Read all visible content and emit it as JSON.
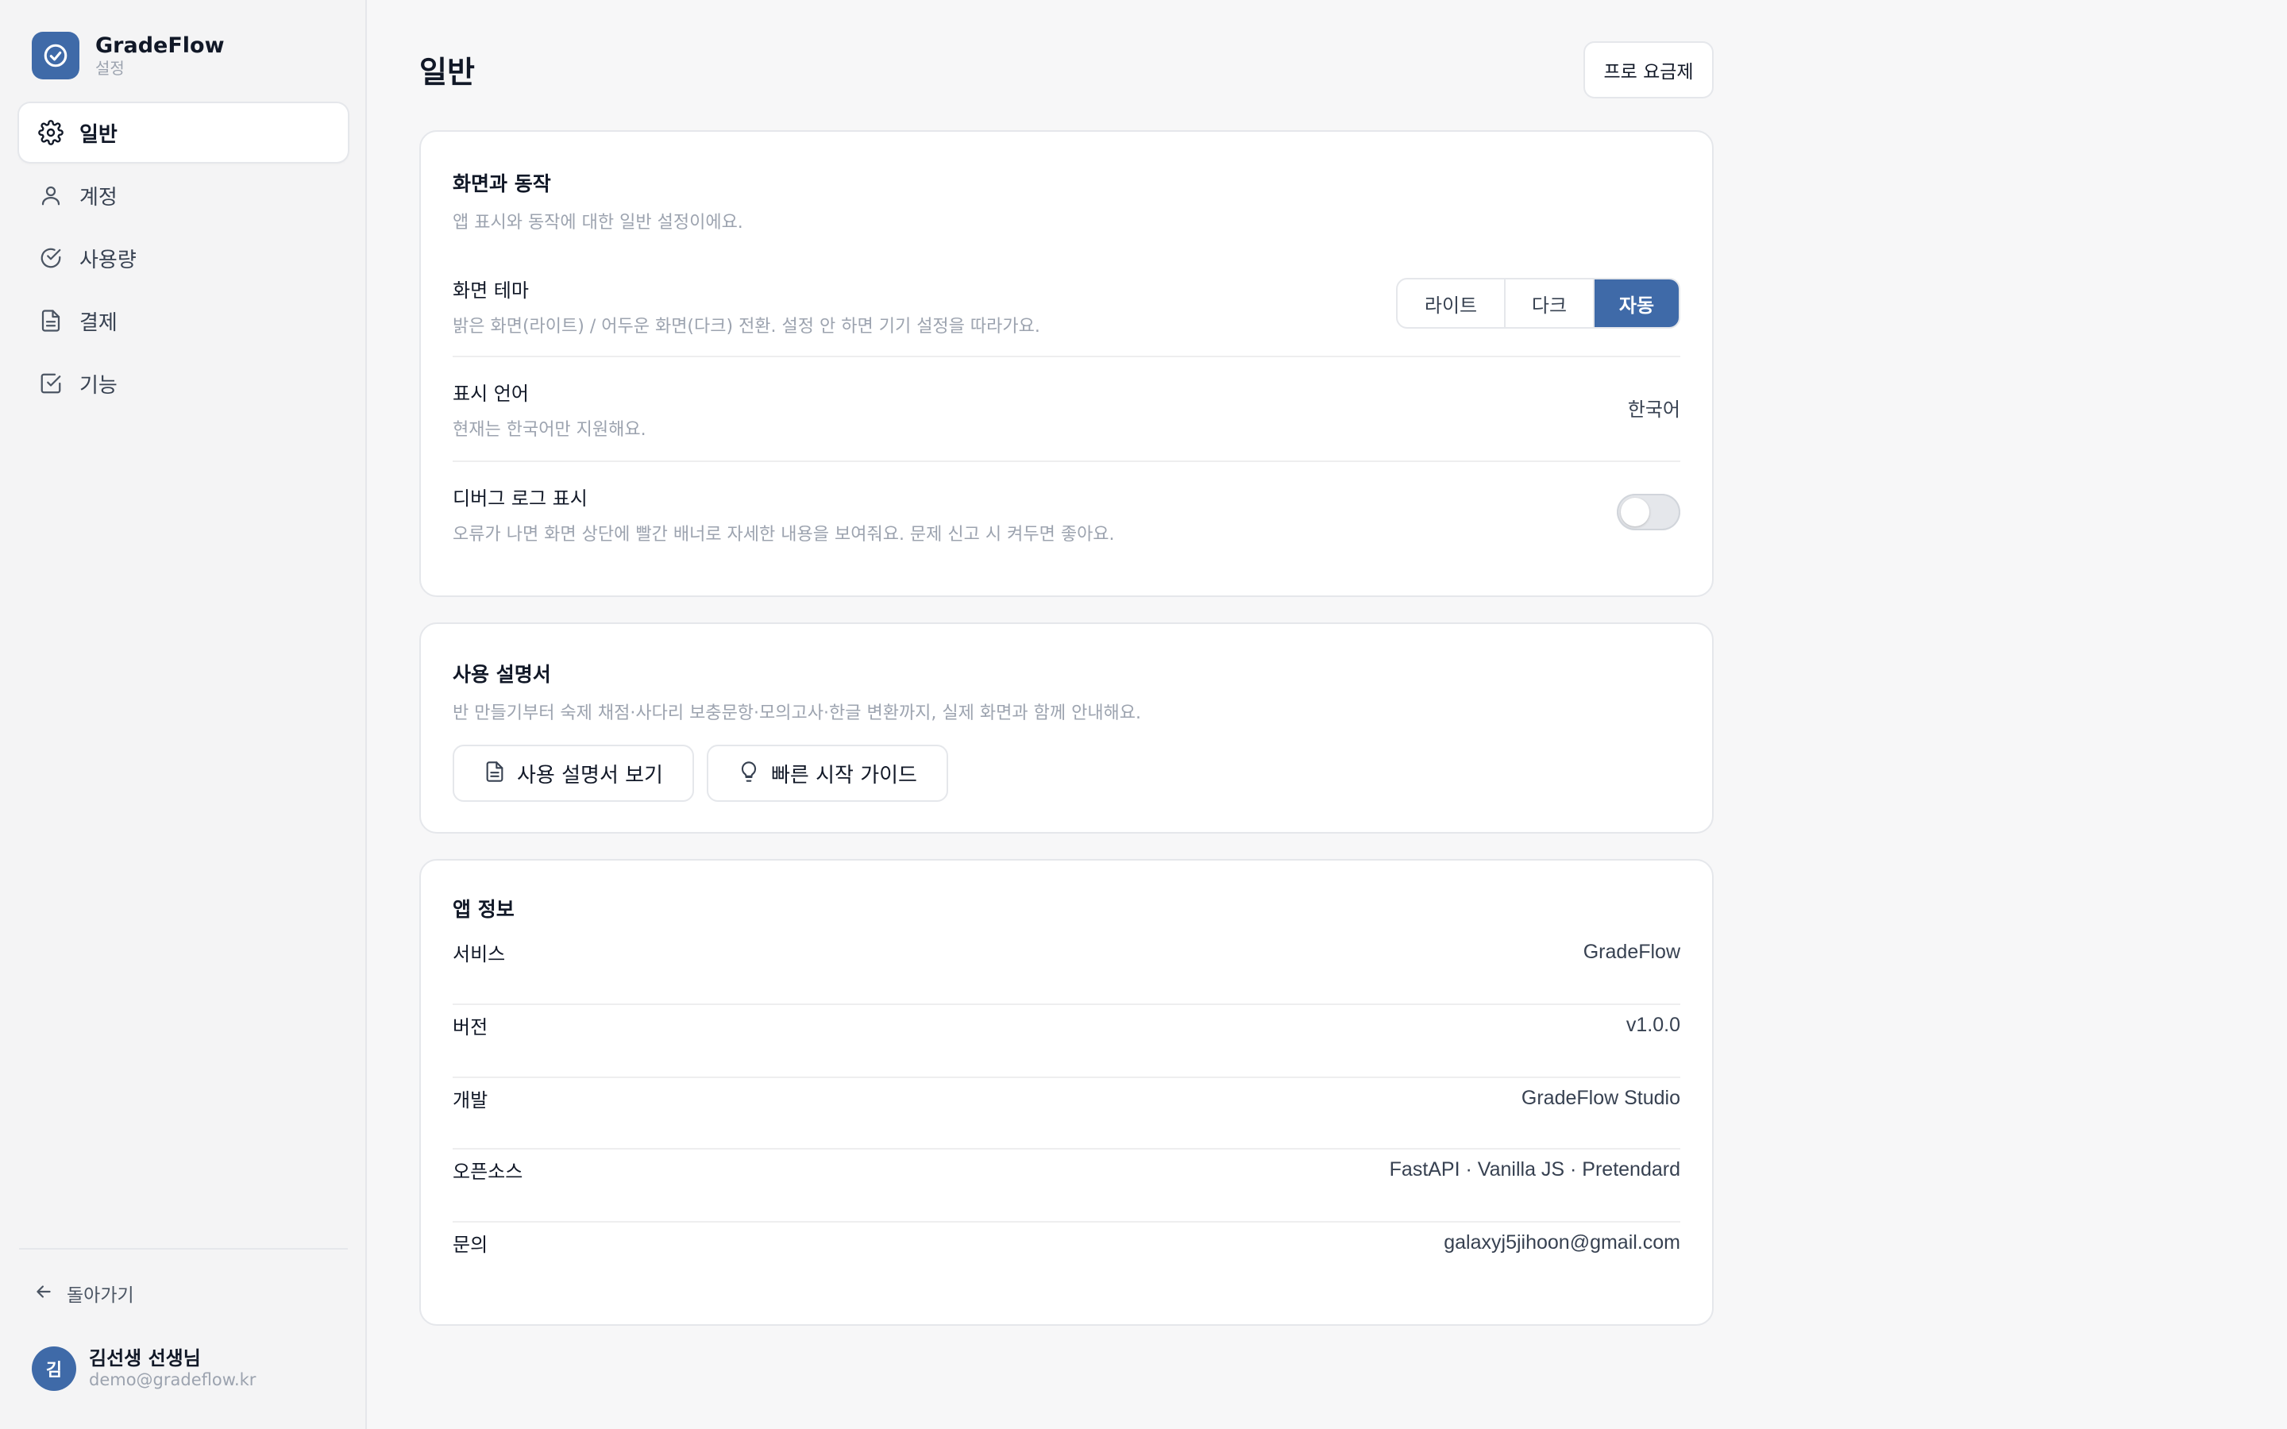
{
  "brand": {
    "name": "GradeFlow",
    "subtitle": "설정"
  },
  "sidebar": {
    "items": [
      {
        "label": "일반",
        "icon": "gear-icon",
        "active": true
      },
      {
        "label": "계정",
        "icon": "user-icon",
        "active": false
      },
      {
        "label": "사용량",
        "icon": "check-circle-icon",
        "active": false
      },
      {
        "label": "결제",
        "icon": "document-icon",
        "active": false
      },
      {
        "label": "기능",
        "icon": "check-square-icon",
        "active": false
      }
    ],
    "back_label": "돌아가기",
    "user": {
      "avatar_initial": "김",
      "name": "김선생 선생님",
      "email": "demo@gradeflow.kr"
    }
  },
  "header": {
    "title": "일반",
    "pro_button": "프로 요금제"
  },
  "display_card": {
    "title": "화면과 동작",
    "desc": "앱 표시와 동작에 대한 일반 설정이에요.",
    "theme": {
      "label": "화면 테마",
      "desc": "밝은 화면(라이트) / 어두운 화면(다크) 전환. 설정 안 하면 기기 설정을 따라가요.",
      "options": [
        "라이트",
        "다크",
        "자동"
      ],
      "selected": "자동"
    },
    "language": {
      "label": "표시 언어",
      "desc": "현재는 한국어만 지원해요.",
      "value": "한국어"
    },
    "debug": {
      "label": "디버그 로그 표시",
      "desc": "오류가 나면 화면 상단에 빨간 배너로 자세한 내용을 보여줘요. 문제 신고 시 켜두면 좋아요.",
      "enabled": false
    }
  },
  "manual_card": {
    "title": "사용 설명서",
    "desc": "반 만들기부터 숙제 채점·사다리 보충문항·모의고사·한글 변환까지, 실제 화면과 함께 안내해요.",
    "view_button": "사용 설명서 보기",
    "quickstart_button": "빠른 시작 가이드"
  },
  "info_card": {
    "title": "앱 정보",
    "rows": [
      {
        "key": "서비스",
        "value": "GradeFlow"
      },
      {
        "key": "버전",
        "value": "v1.0.0"
      },
      {
        "key": "개발",
        "value": "GradeFlow Studio"
      },
      {
        "key": "오픈소스",
        "value": "FastAPI · Vanilla JS · Pretendard"
      },
      {
        "key": "문의",
        "value": "galaxyj5jihoon@gmail.com"
      }
    ]
  },
  "colors": {
    "accent": "#3f6aa8",
    "background": "#f7f7f8",
    "sidebar": "#f4f4f5"
  }
}
